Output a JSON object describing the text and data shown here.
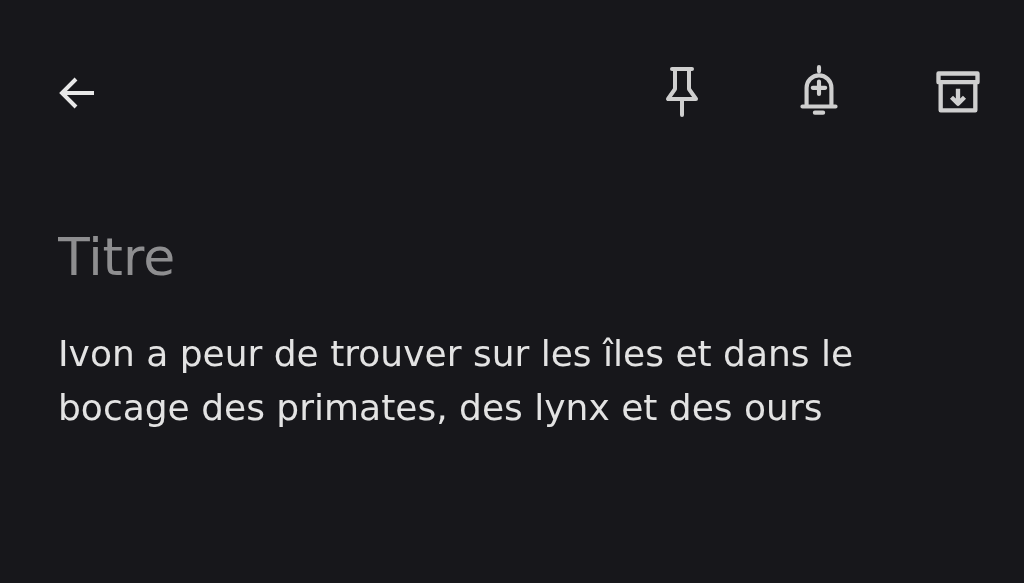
{
  "title": {
    "placeholder": "Titre"
  },
  "note": {
    "value": "Ivon a peur de trouver sur les îles et dans le bocage des primates, des lynx et des ours"
  }
}
